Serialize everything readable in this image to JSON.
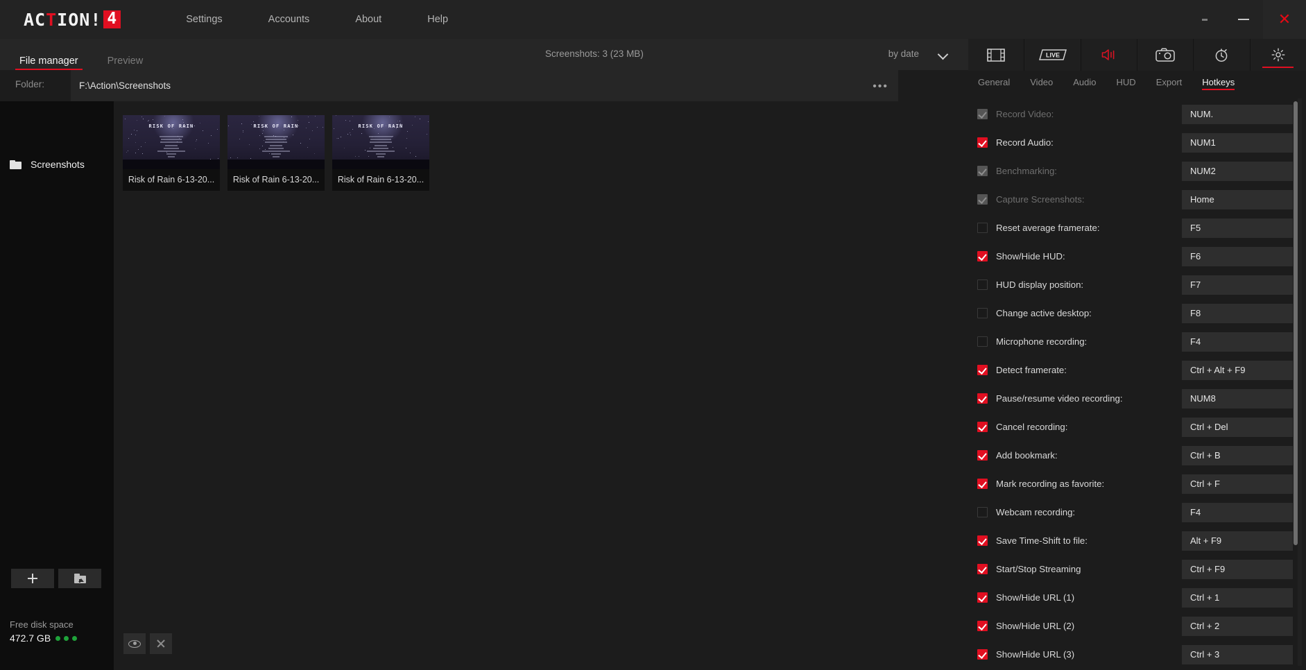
{
  "titlebar": {
    "logo_white_1": "AC",
    "logo_red": "T",
    "logo_white_2": "ION!",
    "logo_badge": "4",
    "menu": [
      {
        "label": "Settings"
      },
      {
        "label": "Accounts"
      },
      {
        "label": "About"
      },
      {
        "label": "Help"
      }
    ],
    "window_controls": {
      "restore": "",
      "minimize": "",
      "close": "✕"
    }
  },
  "file_manager": {
    "tabs": [
      {
        "label": "File manager",
        "active": true
      },
      {
        "label": "Preview",
        "active": false
      }
    ],
    "meta": "Screenshots: 3 (23 MB)",
    "sort_label": "by date",
    "folder_label": "Folder:",
    "folder_path": "F:\\Action\\Screenshots",
    "folder_more": "•••",
    "tree": [
      {
        "label": "Screenshots"
      }
    ],
    "tree_buttons": {
      "add": "add-folder",
      "open": "open-folder"
    },
    "disk": {
      "label": "Free disk space",
      "value": "472.7 GB"
    },
    "thumbnails": [
      {
        "game_title": "RISK OF RAIN",
        "caption": "Risk of Rain 6-13-20..."
      },
      {
        "game_title": "RISK OF RAIN",
        "caption": "Risk of Rain 6-13-20..."
      },
      {
        "game_title": "RISK OF RAIN",
        "caption": "Risk of Rain 6-13-20..."
      }
    ],
    "bottom_actions": [
      {
        "name": "preview",
        "icon": "eye-icon"
      },
      {
        "name": "delete",
        "icon": "close-icon"
      }
    ]
  },
  "right_panel": {
    "modes": [
      {
        "name": "video-recording",
        "icon": "film-strip-icon",
        "active": false
      },
      {
        "name": "live-streaming",
        "icon": "live-icon",
        "active": false
      },
      {
        "name": "audio-recording",
        "icon": "speaker-icon",
        "active": false
      },
      {
        "name": "screenshots",
        "icon": "camera-icon",
        "active": false
      },
      {
        "name": "time-shift",
        "icon": "stopwatch-icon",
        "active": false
      },
      {
        "name": "settings",
        "icon": "gear-icon",
        "active": true
      }
    ],
    "subtabs": [
      {
        "label": "General",
        "active": false
      },
      {
        "label": "Video",
        "active": false
      },
      {
        "label": "Audio",
        "active": false
      },
      {
        "label": "HUD",
        "active": false
      },
      {
        "label": "Export",
        "active": false
      },
      {
        "label": "Hotkeys",
        "active": true
      }
    ],
    "hotkeys": [
      {
        "label": "Record Video:",
        "key": "NUM.",
        "state": "disabled"
      },
      {
        "label": "Record Audio:",
        "key": "NUM1",
        "state": "on"
      },
      {
        "label": "Benchmarking:",
        "key": "NUM2",
        "state": "disabled"
      },
      {
        "label": "Capture Screenshots:",
        "key": "Home",
        "state": "disabled"
      },
      {
        "label": "Reset average framerate:",
        "key": "F5",
        "state": "off"
      },
      {
        "label": "Show/Hide HUD:",
        "key": "F6",
        "state": "on"
      },
      {
        "label": "HUD display position:",
        "key": "F7",
        "state": "off"
      },
      {
        "label": "Change active desktop:",
        "key": "F8",
        "state": "off"
      },
      {
        "label": "Microphone recording:",
        "key": "F4",
        "state": "off"
      },
      {
        "label": "Detect framerate:",
        "key": "Ctrl + Alt + F9",
        "state": "on"
      },
      {
        "label": "Pause/resume video recording:",
        "key": "NUM8",
        "state": "on"
      },
      {
        "label": "Cancel recording:",
        "key": "Ctrl + Del",
        "state": "on"
      },
      {
        "label": "Add bookmark:",
        "key": "Ctrl + B",
        "state": "on"
      },
      {
        "label": "Mark recording as favorite:",
        "key": "Ctrl + F",
        "state": "on"
      },
      {
        "label": "Webcam recording:",
        "key": "F4",
        "state": "off"
      },
      {
        "label": "Save Time-Shift to file:",
        "key": "Alt + F9",
        "state": "on"
      },
      {
        "label": "Start/Stop Streaming",
        "key": "Ctrl + F9",
        "state": "on"
      },
      {
        "label": "Show/Hide URL (1)",
        "key": "Ctrl + 1",
        "state": "on"
      },
      {
        "label": "Show/Hide URL (2)",
        "key": "Ctrl + 2",
        "state": "on"
      },
      {
        "label": "Show/Hide URL (3)",
        "key": "Ctrl + 3",
        "state": "on"
      }
    ]
  },
  "colors": {
    "accent": "#e10f21",
    "panel": "#1c1c1c",
    "bar": "#232323",
    "input": "#2e2e2e",
    "ok": "#1fa33a"
  }
}
